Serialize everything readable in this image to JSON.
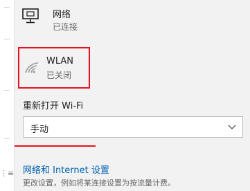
{
  "network": {
    "title": "网络",
    "status": "已连接",
    "icon": "monitor-icon"
  },
  "wlan": {
    "title": "WLAN",
    "status": "已关闭",
    "icon": "wifi-icon",
    "highlight_color": "#e81123"
  },
  "wifi_reopen": {
    "label": "重新打开 Wi-Fi",
    "selected": "手动"
  },
  "network_settings": {
    "link": "网络和 Internet 设置",
    "description": "更改设置，例如将某连接设置为按流量计费。"
  },
  "left_strip": {
    "icon_glyph": "⋮≡"
  },
  "colors": {
    "link": "#0063b1",
    "accent_red": "#e81123",
    "panel_bg": "#f2f2f2"
  }
}
